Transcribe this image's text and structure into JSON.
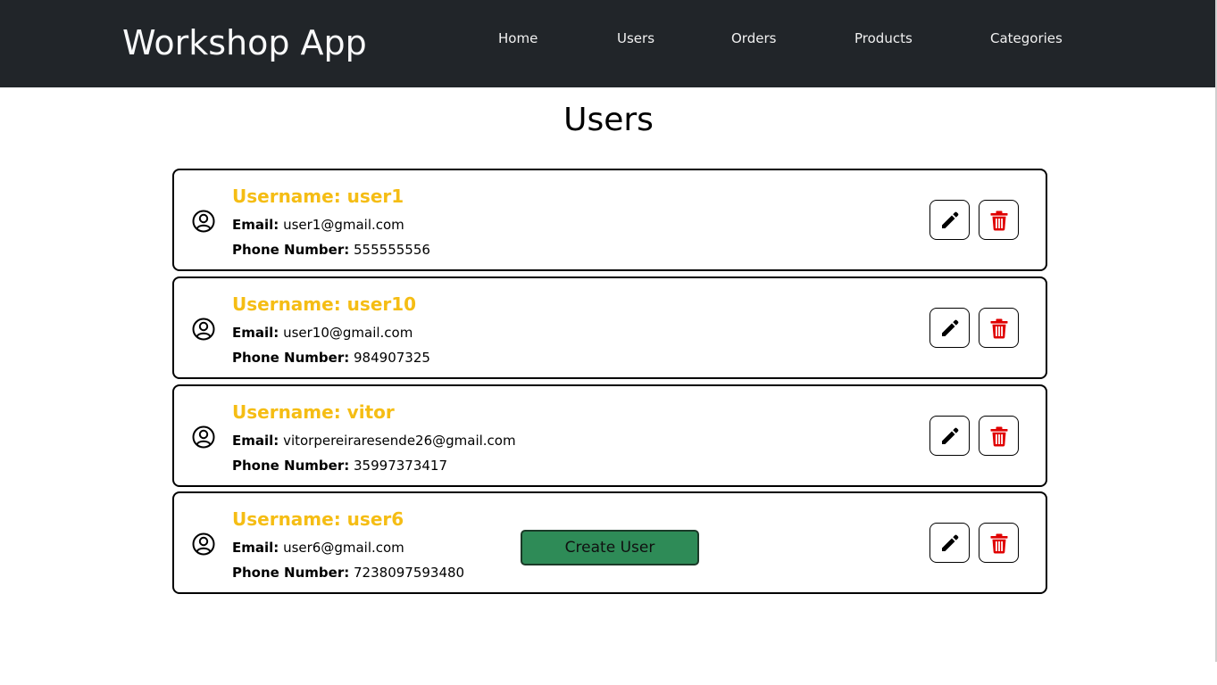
{
  "navbar": {
    "brand": "Workshop App",
    "links": [
      "Home",
      "Users",
      "Orders",
      "Products",
      "Categories"
    ]
  },
  "page": {
    "title": "Users"
  },
  "labels": {
    "username_prefix": "Username:",
    "email": "Email:",
    "phone": "Phone Number:"
  },
  "users": [
    {
      "username": "Username: user1",
      "email": "user1@gmail.com",
      "phone": "555555556"
    },
    {
      "username": "Username: user10",
      "email": "user10@gmail.com",
      "phone": "984907325"
    },
    {
      "username": "Username: vitor",
      "email": "vitorpereiraresende26@gmail.com",
      "phone": "35997373417"
    },
    {
      "username": "Username: user6",
      "email": "user6@gmail.com",
      "phone": "7238097593480"
    }
  ],
  "actions": {
    "create_user": "Create User"
  },
  "icons": {
    "user": "user-circle-icon",
    "edit": "pencil-icon",
    "delete": "trash-icon"
  },
  "colors": {
    "navbar": "#212529",
    "username": "#f5bd14",
    "delete": "#e00000",
    "create_button": "#2e8b57"
  }
}
